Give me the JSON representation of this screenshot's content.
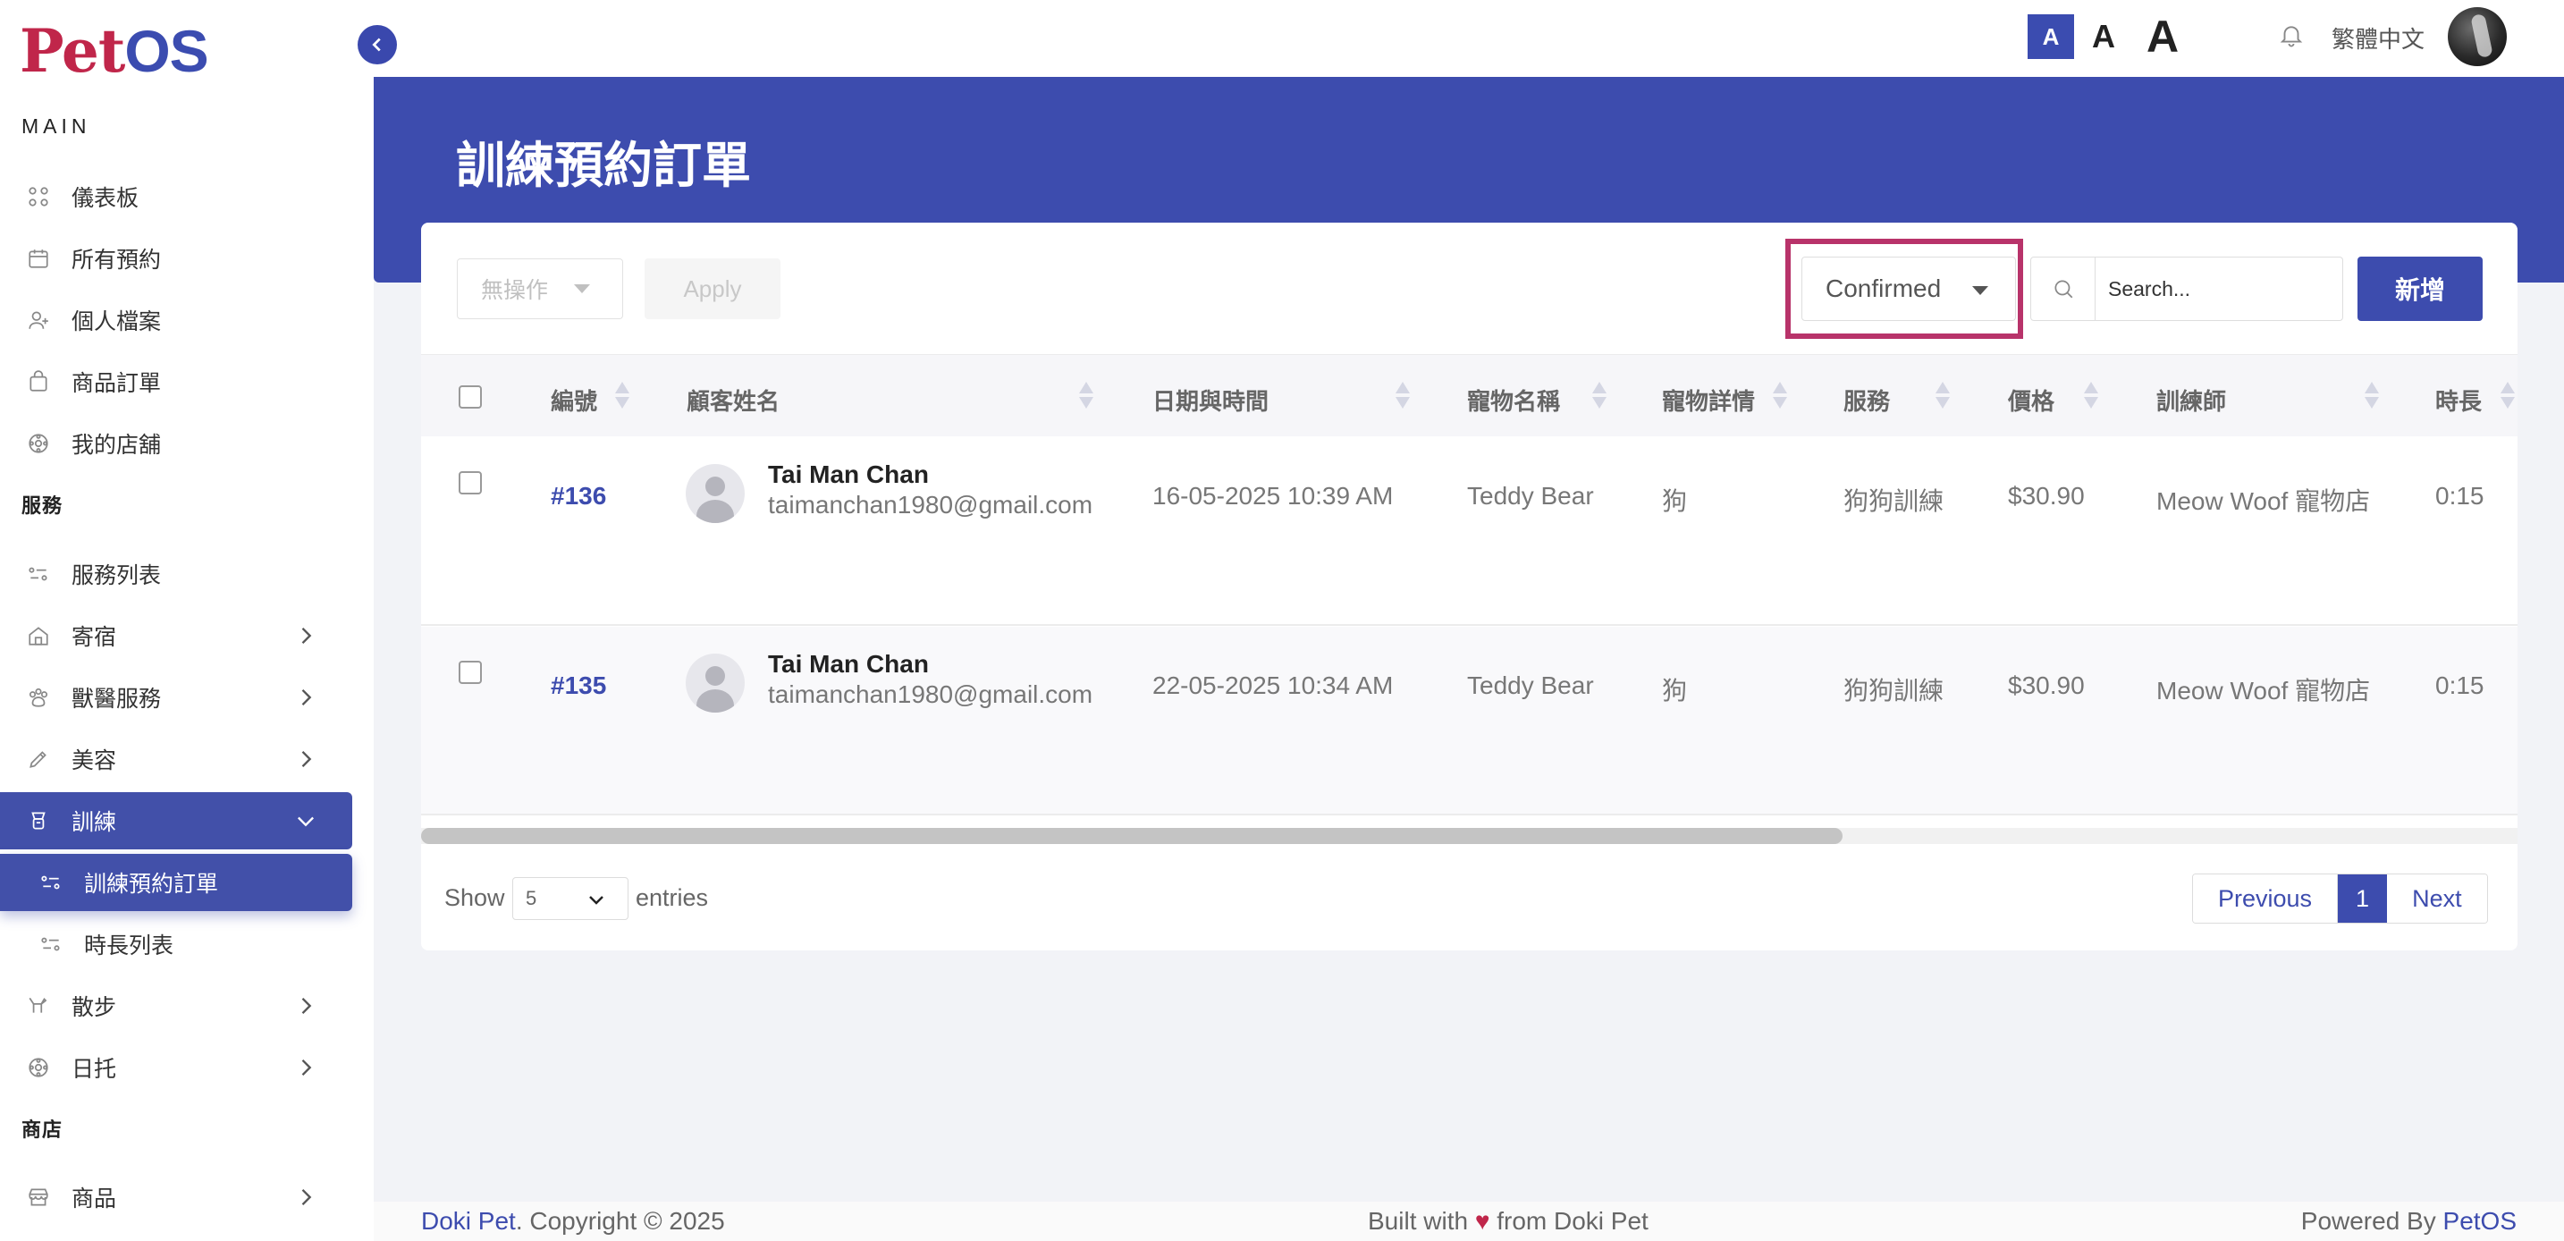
{
  "brand": {
    "logo_p": "P",
    "logo_et": "et",
    "logo_os": "OS"
  },
  "sidebar": {
    "sections": {
      "main": "MAIN",
      "services": "服務",
      "shop": "商店"
    },
    "items": [
      {
        "label": "儀表板",
        "icon": "dashboard-icon"
      },
      {
        "label": "所有預約",
        "icon": "calendar-icon"
      },
      {
        "label": "個人檔案",
        "icon": "user-icon"
      },
      {
        "label": "商品訂單",
        "icon": "bag-icon"
      },
      {
        "label": "我的店舖",
        "icon": "paw-icon"
      },
      {
        "label": "服務列表",
        "icon": "list-icon"
      },
      {
        "label": "寄宿",
        "icon": "home-icon"
      },
      {
        "label": "獸醫服務",
        "icon": "paw-icon"
      },
      {
        "label": "美容",
        "icon": "brush-icon"
      },
      {
        "label": "訓練",
        "icon": "training-icon"
      },
      {
        "label": "訓練預約訂單",
        "icon": "list-icon"
      },
      {
        "label": "時長列表",
        "icon": "list-icon"
      },
      {
        "label": "散步",
        "icon": "dog-walk-icon"
      },
      {
        "label": "日托",
        "icon": "paw-icon"
      },
      {
        "label": "商品",
        "icon": "store-icon"
      }
    ]
  },
  "topbar": {
    "font_small": "A",
    "font_medium": "A",
    "font_large": "A",
    "language": "繁體中文"
  },
  "page": {
    "title": "訓練預約訂單"
  },
  "toolbar": {
    "bulk_action": "無操作",
    "apply": "Apply",
    "status_filter": "Confirmed",
    "search_placeholder": "Search...",
    "add": "新增"
  },
  "table": {
    "headers": [
      "編號",
      "顧客姓名",
      "日期與時間",
      "寵物名稱",
      "寵物詳情",
      "服務",
      "價格",
      "訓練師",
      "時長"
    ],
    "rows": [
      {
        "id": "#136",
        "name": "Tai Man Chan",
        "email": "taimanchan1980@gmail.com",
        "datetime": "16-05-2025 10:39 AM",
        "pet": "Teddy Bear",
        "pet_detail": "狗",
        "service": "狗狗訓練",
        "price": "$30.90",
        "trainer": "Meow Woof 寵物店",
        "duration": "0:15"
      },
      {
        "id": "#135",
        "name": "Tai Man Chan",
        "email": "taimanchan1980@gmail.com",
        "datetime": "22-05-2025 10:34 AM",
        "pet": "Teddy Bear",
        "pet_detail": "狗",
        "service": "狗狗訓練",
        "price": "$30.90",
        "trainer": "Meow Woof 寵物店",
        "duration": "0:15"
      }
    ]
  },
  "pagination": {
    "show": "Show",
    "length": "5",
    "entries": "entries",
    "previous": "Previous",
    "current": "1",
    "next": "Next"
  },
  "footer": {
    "brand": "Doki Pet",
    "copyright": ". Copyright © 2025",
    "built_pre": "Built with",
    "built_post": "from Doki Pet",
    "powered_pre": "Powered By",
    "powered_brand": "PetOS"
  },
  "colors": {
    "primary": "#3d4cae",
    "accent": "#c0264a",
    "highlight_border": "#b8336a"
  }
}
